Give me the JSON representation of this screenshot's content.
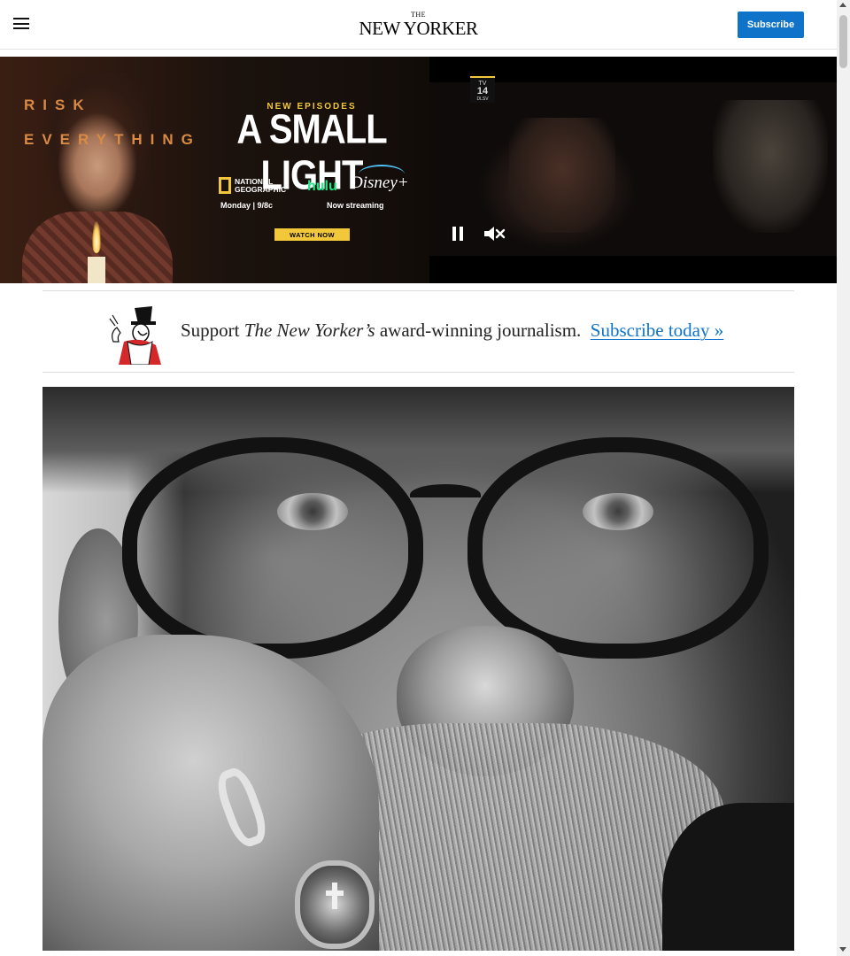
{
  "header": {
    "logo_top": "THE",
    "logo_main": "NEW YORKER",
    "subscribe_label": "Subscribe",
    "menu_icon": "hamburger-menu-icon"
  },
  "ad": {
    "tagline": "RISK EVERYTHING",
    "tagline_line1": "RISK",
    "tagline_line2": "EVERYTHING",
    "new_episodes": "NEW EPISODES",
    "title": "A SMALL LIGHT",
    "network_1": "NATIONAL GEOGRAPHIC",
    "network_2": "hulu",
    "network_3": "Disney+",
    "schedule": "Monday | 9/8c",
    "streaming": "Now streaming",
    "cta": "WATCH NOW",
    "rating_top": "TV",
    "rating_num": "14",
    "rating_bottom": "DLSV",
    "video_controls": [
      "pause-icon",
      "mute-icon"
    ]
  },
  "support": {
    "prefix": "Support ",
    "publication": "The New Yorker’s",
    "suffix": " award-winning journalism.",
    "link": "Subscribe today »"
  },
  "colors": {
    "accent": "#0f74c9",
    "ad_gold": "#f2c83a",
    "ad_orange": "#d98a44",
    "hulu_green": "#1ce783"
  }
}
